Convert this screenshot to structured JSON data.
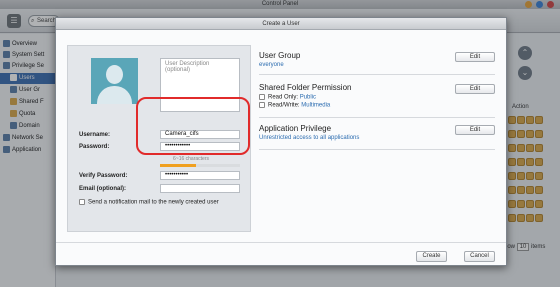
{
  "window": {
    "title": "Control Panel",
    "btn_colors": [
      "#e8a33a",
      "#3b82d6",
      "#d24646"
    ]
  },
  "toolbar": {
    "home_icon": "grid-icon",
    "search_label": "Search"
  },
  "sidebar": {
    "items": [
      {
        "label": "Overview",
        "selected": false
      },
      {
        "label": "System Sett",
        "selected": false
      },
      {
        "label": "Privilege Se",
        "selected": false
      },
      {
        "label": "Users",
        "selected": true
      },
      {
        "label": "User Gr",
        "selected": false
      },
      {
        "label": "Shared F",
        "selected": false
      },
      {
        "label": "Quota",
        "selected": false
      },
      {
        "label": "Domain",
        "selected": false
      },
      {
        "label": "Network Se",
        "selected": false
      },
      {
        "label": "Application",
        "selected": false
      }
    ]
  },
  "background_list": {
    "action_header": "Action",
    "pager_prefix": "Show",
    "pager_value": "10",
    "pager_suffix": "items"
  },
  "dialog": {
    "title": "Create a User",
    "description_placeholder": "User Description (optional)",
    "username_label": "Username:",
    "username_value": "Camera_cifs",
    "password_label": "Password:",
    "password_value": "••••••••••••",
    "password_hint": "6~16 characters",
    "password_strength": 0.45,
    "verify_label": "Verify Password:",
    "verify_value": "•••••••••••",
    "email_label": "Email (optional):",
    "email_value": "",
    "notify_label": "Send a notification mail to the newly created user",
    "notify_checked": false,
    "user_group": {
      "title": "User Group",
      "value": "everyone",
      "edit_label": "Edit"
    },
    "shared_folder": {
      "title": "Shared Folder Permission",
      "read_only_label": "Read Only:",
      "read_only_value": "Public",
      "read_write_label": "Read/Write:",
      "read_write_value": "Multimedia",
      "edit_label": "Edit"
    },
    "app_privilege": {
      "title": "Application Privilege",
      "value": "Unrestricted access to all applications",
      "edit_label": "Edit"
    },
    "create_label": "Create",
    "cancel_label": "Cancel"
  },
  "colors": {
    "accent": "#2b6cb0",
    "highlight": "#e12b2b",
    "avatar": "#5aa6b8",
    "strength": "#f0a020"
  }
}
